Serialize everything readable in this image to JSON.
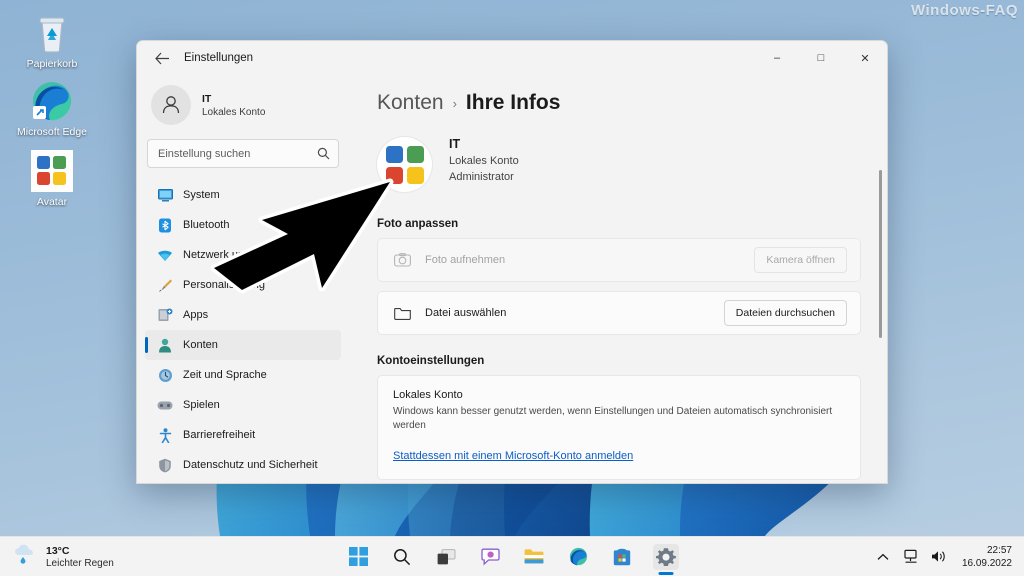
{
  "desktop": {
    "watermark": "Windows-FAQ",
    "icons": [
      {
        "label": "Papierkorb",
        "icon": "recycle-bin-icon"
      },
      {
        "label": "Microsoft Edge",
        "icon": "microsoft-edge-icon"
      },
      {
        "label": "Avatar",
        "icon": "microsoft-logo-icon"
      }
    ]
  },
  "window": {
    "title": "Einstellungen",
    "back_icon": "back-arrow-icon",
    "controls": {
      "minimize": "–",
      "maximize": "□",
      "close": "✕"
    }
  },
  "sidebar": {
    "profile": {
      "name": "IT",
      "subtitle": "Lokales Konto",
      "avatar_icon": "person-icon"
    },
    "search": {
      "placeholder": "Einstellung suchen",
      "value": "",
      "icon": "search-icon"
    },
    "items": [
      {
        "label": "System",
        "icon": "system-icon",
        "active": false
      },
      {
        "label": "Bluetooth",
        "icon": "bluetooth-icon",
        "active": false
      },
      {
        "label": "Netzwerk und Internet",
        "icon": "network-icon",
        "active": false
      },
      {
        "label": "Personalisierung",
        "icon": "personalization-brush-icon",
        "active": false
      },
      {
        "label": "Apps",
        "icon": "apps-icon",
        "active": false
      },
      {
        "label": "Konten",
        "icon": "accounts-person-icon",
        "active": true
      },
      {
        "label": "Zeit und Sprache",
        "icon": "time-language-icon",
        "active": false
      },
      {
        "label": "Spielen",
        "icon": "gaming-controller-icon",
        "active": false
      },
      {
        "label": "Barrierefreiheit",
        "icon": "accessibility-icon",
        "active": false
      },
      {
        "label": "Datenschutz und Sicherheit",
        "icon": "privacy-shield-icon",
        "active": false
      }
    ]
  },
  "content": {
    "breadcrumb": {
      "parent": "Konten",
      "separator": "›",
      "current": "Ihre Infos"
    },
    "account": {
      "avatar_icon": "microsoft-logo-icon",
      "name": "IT",
      "account_type": "Lokales Konto",
      "role": "Administrator"
    },
    "photo_section": {
      "heading": "Foto anpassen",
      "rows": [
        {
          "label": "Foto aufnehmen",
          "icon": "camera-icon",
          "button": "Kamera öffnen",
          "disabled": true
        },
        {
          "label": "Datei auswählen",
          "icon": "folder-icon",
          "button": "Dateien durchsuchen",
          "disabled": false
        }
      ]
    },
    "account_settings": {
      "heading": "Kontoeinstellungen",
      "title": "Lokales Konto",
      "description": "Windows kann besser genutzt werden, wenn Einstellungen und Dateien automatisch synchronisiert werden",
      "link": "Stattdessen mit einem Microsoft-Konto anmelden",
      "link_color": "#0b5ec7"
    }
  },
  "taskbar": {
    "weather": {
      "temperature": "13°C",
      "description": "Leichter Regen",
      "icon": "rain-cloud-icon"
    },
    "buttons": [
      {
        "name": "start-button",
        "icon": "windows-start-icon",
        "active": false
      },
      {
        "name": "search-button",
        "icon": "search-icon",
        "active": false
      },
      {
        "name": "task-view-button",
        "icon": "task-view-icon",
        "active": false
      },
      {
        "name": "chat-button",
        "icon": "chat-icon",
        "active": false
      },
      {
        "name": "file-explorer-button",
        "icon": "folder-icon",
        "active": false
      },
      {
        "name": "edge-button",
        "icon": "microsoft-edge-icon",
        "active": false
      },
      {
        "name": "store-button",
        "icon": "microsoft-store-icon",
        "active": false
      },
      {
        "name": "settings-button",
        "icon": "gear-icon",
        "active": true
      }
    ],
    "tray": {
      "overflow_icon": "chevron-up-icon",
      "network_icon": "network-icon",
      "volume_icon": "volume-icon",
      "time": "22:57",
      "date": "16.09.2022"
    }
  },
  "overlay": {
    "cursor_icon": "large-arrow-cursor-icon"
  },
  "colors": {
    "accent": "#0078d4",
    "selection_bar": "#0067c0",
    "link": "#0b5ec7",
    "window_bg": "#f3f3f3",
    "card_bg": "#fbfbfb"
  }
}
